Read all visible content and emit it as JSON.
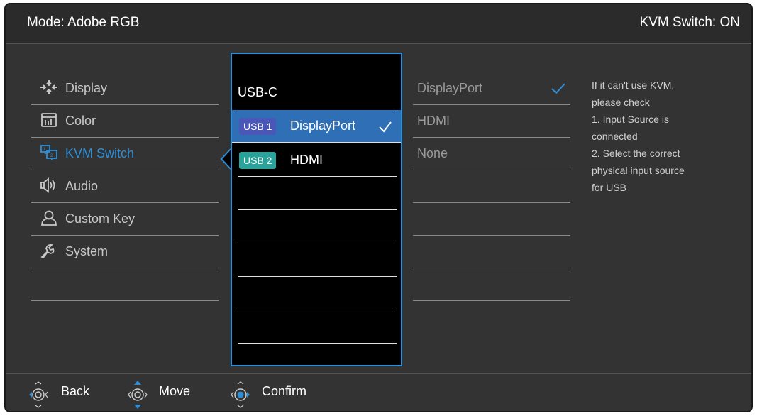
{
  "header": {
    "mode": "Mode: Adobe RGB",
    "status": "KVM Switch: ON"
  },
  "menu": {
    "items": [
      {
        "label": "Display",
        "icon": "display-icon"
      },
      {
        "label": "Color",
        "icon": "color-icon"
      },
      {
        "label": "KVM Switch",
        "icon": "kvm-switch-icon",
        "active": true
      },
      {
        "label": "Audio",
        "icon": "audio-icon"
      },
      {
        "label": "Custom Key",
        "icon": "custom-key-icon"
      },
      {
        "label": "System",
        "icon": "system-icon"
      }
    ]
  },
  "submenu": {
    "title": "USB-C",
    "options": [
      {
        "tag": "USB 1",
        "label": "DisplayPort",
        "selected": true
      },
      {
        "tag": "USB 2",
        "label": "HDMI"
      }
    ]
  },
  "thirdcol": {
    "options": [
      {
        "label": "DisplayPort",
        "checked": true
      },
      {
        "label": "HDMI"
      },
      {
        "label": "None"
      }
    ]
  },
  "info": {
    "lines": [
      "If it can't use KVM,",
      "please check",
      "1. Input Source is",
      "connected",
      "2. Select the correct",
      "physical input source",
      "for USB"
    ]
  },
  "footer": {
    "back": "Back",
    "move": "Move",
    "confirm": "Confirm"
  },
  "colors": {
    "accent": "#2e8fd6",
    "usb1": "#4a56b8",
    "usb2": "#2aa39a",
    "background": "#333333"
  }
}
